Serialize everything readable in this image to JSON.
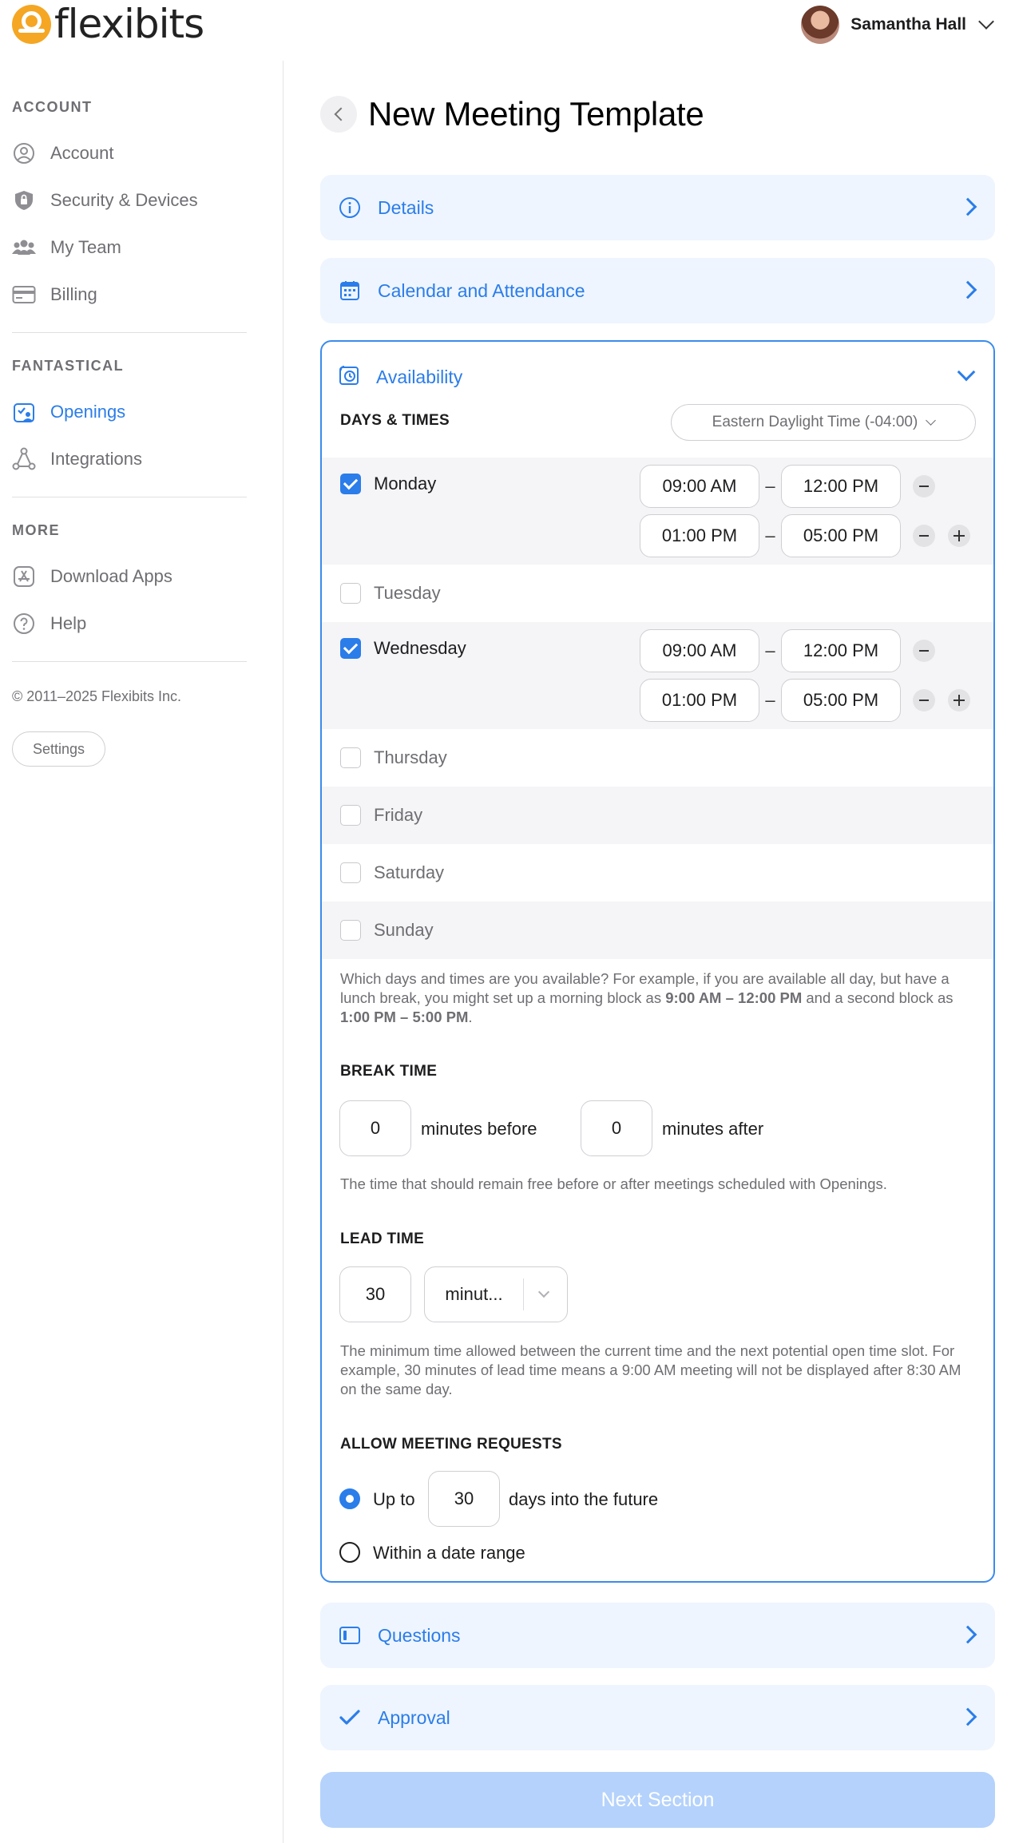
{
  "brand": {
    "name": "flexibits",
    "accent": "#f5a623"
  },
  "user": {
    "name": "Samantha Hall"
  },
  "sidebar": {
    "sections": [
      {
        "label": "ACCOUNT"
      },
      {
        "label": "FANTASTICAL"
      },
      {
        "label": "MORE"
      }
    ],
    "items": [
      {
        "label": "Account",
        "icon": "user-circle-icon"
      },
      {
        "label": "Security & Devices",
        "icon": "shield-lock-icon"
      },
      {
        "label": "My Team",
        "icon": "team-icon"
      },
      {
        "label": "Billing",
        "icon": "credit-card-icon"
      },
      {
        "label": "Openings",
        "icon": "openings-icon",
        "active": true
      },
      {
        "label": "Integrations",
        "icon": "integrations-icon"
      },
      {
        "label": "Download Apps",
        "icon": "app-store-icon"
      },
      {
        "label": "Help",
        "icon": "help-icon"
      }
    ],
    "copyright": "© 2011–2025 Flexibits Inc.",
    "settings_label": "Settings"
  },
  "page": {
    "title": "New Meeting Template"
  },
  "sections": {
    "details": "Details",
    "calendar": "Calendar and Attendance",
    "availability": "Availability",
    "questions": "Questions",
    "approval": "Approval"
  },
  "availability": {
    "days_times_heading": "DAYS & TIMES",
    "timezone": "Eastern Daylight Time (-04:00)",
    "days": [
      {
        "name": "Monday",
        "checked": true,
        "slots": [
          {
            "start": "09:00 AM",
            "end": "12:00 PM"
          },
          {
            "start": "01:00 PM",
            "end": "05:00 PM"
          }
        ]
      },
      {
        "name": "Tuesday",
        "checked": false,
        "slots": []
      },
      {
        "name": "Wednesday",
        "checked": true,
        "slots": [
          {
            "start": "09:00 AM",
            "end": "12:00 PM"
          },
          {
            "start": "01:00 PM",
            "end": "05:00 PM"
          }
        ]
      },
      {
        "name": "Thursday",
        "checked": false,
        "slots": []
      },
      {
        "name": "Friday",
        "checked": false,
        "slots": []
      },
      {
        "name": "Saturday",
        "checked": false,
        "slots": []
      },
      {
        "name": "Sunday",
        "checked": false,
        "slots": []
      }
    ],
    "days_help": {
      "part1": "Which days and times are you available? For example, if you are available all day, but have a lunch break, you might set up a morning block as ",
      "bold1": "9:00 AM – 12:00 PM",
      "part2": " and a second block as ",
      "bold2": "1:00 PM – 5:00 PM",
      "part3": "."
    },
    "break_heading": "BREAK TIME",
    "break_before_value": "0",
    "break_before_label": "minutes before",
    "break_after_value": "0",
    "break_after_label": "minutes after",
    "break_help": "The time that should remain free before or after meetings scheduled with Openings.",
    "lead_heading": "LEAD TIME",
    "lead_value": "30",
    "lead_unit": "minut...",
    "lead_help": "The minimum time allowed between the current time and the next potential open time slot. For example, 30 minutes of lead time means a 9:00 AM meeting will not be displayed after 8:30 AM on the same day.",
    "requests_heading": "ALLOW MEETING REQUESTS",
    "upto_label": "Up to",
    "upto_value": "30",
    "upto_suffix": "days into the future",
    "date_range_label": "Within a date range"
  },
  "next_button": "Next Section"
}
